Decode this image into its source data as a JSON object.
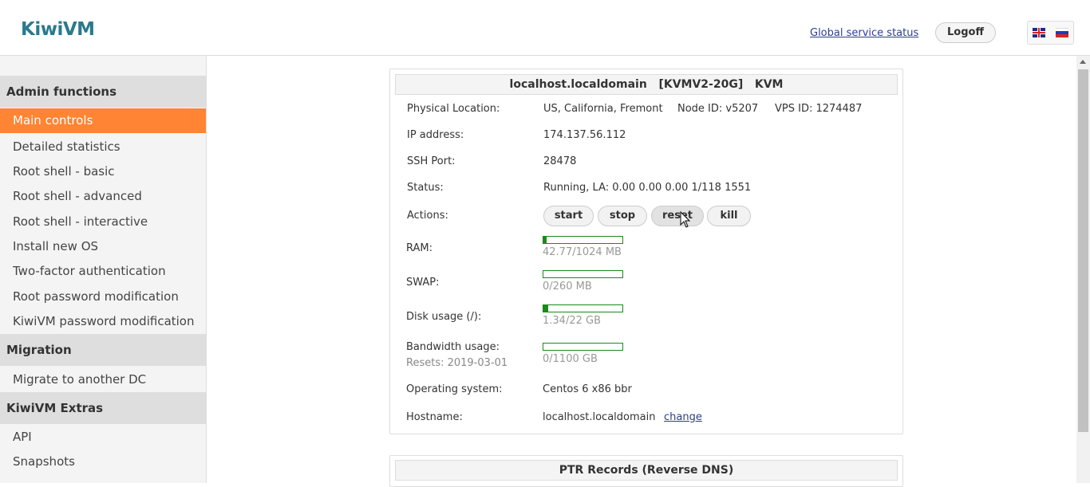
{
  "header": {
    "logo": "KiwiVM",
    "global_status_link": "Global service status",
    "logoff_label": "Logoff",
    "languages": [
      "English",
      "Russian"
    ]
  },
  "sidebar": {
    "sections": [
      {
        "title": "Admin functions",
        "items": [
          "Main controls",
          "Detailed statistics",
          "Root shell - basic",
          "Root shell - advanced",
          "Root shell - interactive",
          "Install new OS",
          "Two-factor authentication",
          "Root password modification",
          "KiwiVM password modification"
        ]
      },
      {
        "title": "Migration",
        "items": [
          "Migrate to another DC"
        ]
      },
      {
        "title": "KiwiVM Extras",
        "items": [
          "API",
          "Snapshots"
        ]
      }
    ],
    "active_item": "Main controls"
  },
  "main": {
    "title": "localhost.localdomain   [KVMV2-20G]   KVM",
    "physical_location_label": "Physical Location:",
    "physical_location_value": "US, California, Fremont",
    "node_id": "Node ID: v5207",
    "vps_id": "VPS ID: 1274487",
    "ip_label": "IP address:",
    "ip_value": "174.137.56.112",
    "ssh_label": "SSH Port:",
    "ssh_value": "28478",
    "status_label": "Status:",
    "status_value": "Running, LA: 0.00 0.00 0.00 1/118 1551",
    "actions_label": "Actions:",
    "actions": [
      "start",
      "stop",
      "reset",
      "kill"
    ],
    "ram_label": "RAM:",
    "ram_text": "42.77/1024 MB",
    "ram_fraction": 0.042,
    "swap_label": "SWAP:",
    "swap_text": "0/260 MB",
    "swap_fraction": 0,
    "disk_label": "Disk usage (/):",
    "disk_text": "1.34/22 GB",
    "disk_fraction": 0.061,
    "bw_label": "Bandwidth usage:",
    "bw_resets": "Resets: 2019-03-01",
    "bw_text": "0/1100 GB",
    "bw_fraction": 0,
    "os_label": "Operating system:",
    "os_value": "Centos 6 x86 bbr",
    "hostname_label": "Hostname:",
    "hostname_value": "localhost.localdomain",
    "hostname_change": "change"
  },
  "ptr": {
    "title": "PTR Records (Reverse DNS)"
  },
  "colors": {
    "accent": "#ff8433",
    "bar": "#1a8a1a",
    "logo": "#2a7a8c"
  }
}
